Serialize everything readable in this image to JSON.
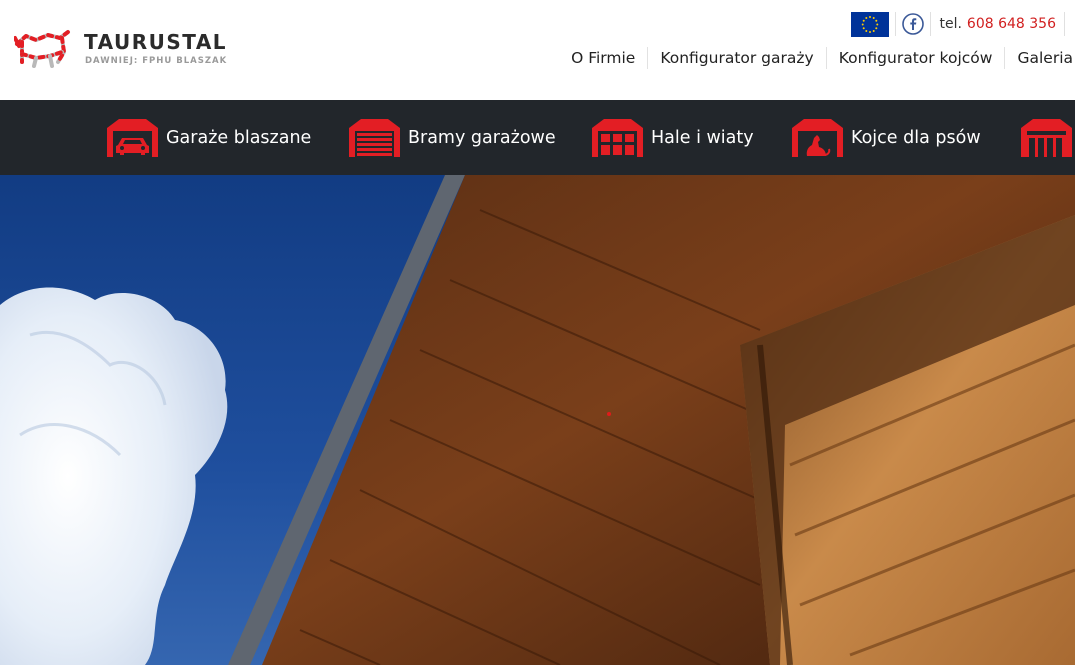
{
  "header": {
    "brand": "TAURUSTAL",
    "brand_sub": "DAWNIEJ: FPHU BLASZAK",
    "tel_label": "tel.",
    "tel_number": "608 648 356",
    "icons": [
      "eu-flag-icon",
      "facebook-icon"
    ]
  },
  "main_nav": {
    "items": [
      "O Firmie",
      "Konfigurator garaży",
      "Konfigurator kojców",
      "Galeria"
    ]
  },
  "categories": {
    "items": [
      {
        "label": "Garaże blaszane",
        "icon": "garage-car-icon"
      },
      {
        "label": "Bramy garażowe",
        "icon": "garage-door-icon"
      },
      {
        "label": "Hale i wiaty",
        "icon": "hall-icon"
      },
      {
        "label": "Kojce dla psów",
        "icon": "dog-kennel-icon"
      },
      {
        "label": "",
        "icon": "shed-icon"
      }
    ]
  },
  "colors": {
    "accent_red": "#e31e24",
    "category_bar": "#22262b",
    "phone_red": "#d11f1f"
  }
}
